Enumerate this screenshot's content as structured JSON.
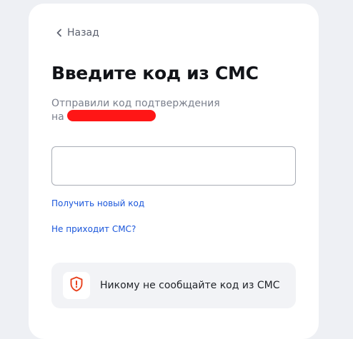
{
  "back": {
    "label": "Назад"
  },
  "title": "Введите код из СМС",
  "subtitle": {
    "line1": "Отправили код подтверждения",
    "line2_prefix": "на"
  },
  "code_input": {
    "value": "",
    "placeholder": ""
  },
  "links": {
    "get_new_code": "Получить новый код",
    "no_sms": "Не приходит СМС?"
  },
  "notice": {
    "icon": "shield-alert-icon",
    "text": "Никому не сообщайте код из СМС"
  },
  "colors": {
    "link": "#1a56db",
    "redaction": "#ff1616",
    "shield": "#e8401c"
  }
}
